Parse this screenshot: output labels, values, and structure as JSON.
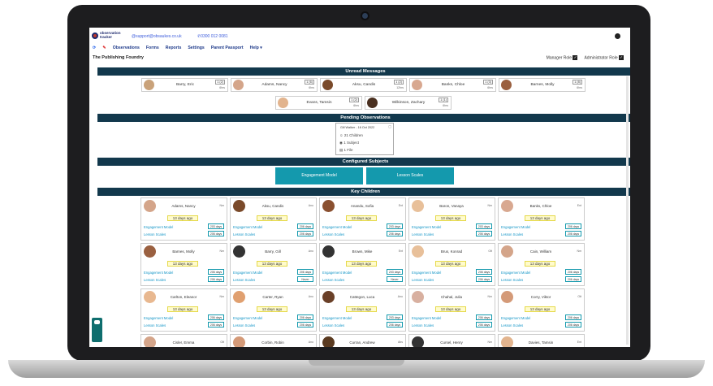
{
  "header": {
    "logo_text": "observation tracker",
    "email": "support@obsaukes.co.uk",
    "phone": "0300 012 0081"
  },
  "nav": {
    "items": [
      "Observations",
      "Forms",
      "Reports",
      "Settings",
      "Parent Passport",
      "Help ▾"
    ]
  },
  "org_name": "The Publishing Foundry",
  "roles": {
    "manager": "Manager Role",
    "administrator": "Administrator Role"
  },
  "sections": {
    "unread": "Unread Messages",
    "pending": "Pending Observations",
    "configured": "Configured Subjects",
    "key_children": "Key Children"
  },
  "messages": [
    {
      "name": "Barry, Eric",
      "count": "1 (2)",
      "age": "6hrs",
      "color": "#c9a27a"
    },
    {
      "name": "Adams, Nancy",
      "count": "1 (6)",
      "age": "6hrs",
      "color": "#d4a58a"
    },
    {
      "name": "Aksu, Candis",
      "count": "1 (2)",
      "age": "12hrs",
      "color": "#7a4a2a"
    },
    {
      "name": "Banks, Chloe",
      "count": "1 (3)",
      "age": "6hrs",
      "color": "#d8a890"
    },
    {
      "name": "Barnes, Molly",
      "count": "1 (8)",
      "age": "6hrs",
      "color": "#9a6040"
    },
    {
      "name": "Evans, Tamsin",
      "count": "1 (2)",
      "age": "6hrs",
      "color": "#e2b48e"
    },
    {
      "name": "Wilkinson, Zachary",
      "count": "1 (1)",
      "age": "6hrs",
      "color": "#4a3020"
    }
  ],
  "pending": {
    "header": "Gill Walker - 16 Oct 2022",
    "children": "21 Children",
    "subject": "1 Subject",
    "file": "1 File"
  },
  "subjects": [
    "Engagement Model",
    "Lesson Scales"
  ],
  "child_labels": {
    "line1": "Engagement Model",
    "line2": "Lesson Scales"
  },
  "children": [
    {
      "name": "Adams, Nancy",
      "ct": "Nm",
      "ago": "13 days ago",
      "b1": "203 days",
      "b2": "206 days",
      "color": "#d4a58a"
    },
    {
      "name": "Aksu, Candis",
      "ct": "Ano",
      "ago": "13 days ago",
      "b1": "206 days",
      "b2": "206 days",
      "color": "#7a4a2a"
    },
    {
      "name": "Anandu, Sofia",
      "ct": "Ent",
      "ago": "13 days ago",
      "b1": "203 days",
      "b2": "206 days",
      "color": "#8a5030"
    },
    {
      "name": "Baron, Vanaya",
      "ct": "Nm",
      "ago": "13 days ago",
      "b1": "203 days",
      "b2": "206 days",
      "color": "#e8c09a"
    },
    {
      "name": "Banks, Chloe",
      "ct": "Ent",
      "ago": "13 days ago",
      "b1": "206 days",
      "b2": "206 days",
      "color": "#d8a890"
    },
    {
      "name": "Barnes, Molly",
      "ct": "Nm",
      "ago": "13 days ago",
      "b1": "206 days",
      "b2": "206 days",
      "color": "#9a6040"
    },
    {
      "name": "Barry, Gill",
      "ct": "Ano",
      "ago": "13 days ago",
      "b1": "206 days",
      "b2": "Never",
      "color": "#333333"
    },
    {
      "name": "Brown, Mike",
      "ct": "Ent",
      "ago": "13 days ago",
      "b1": "203 days",
      "b2": "Never",
      "color": "#333333"
    },
    {
      "name": "Brus, Konrad",
      "ct": "Ott",
      "ago": "13 days ago",
      "b1": "206 days",
      "b2": "206 days",
      "color": "#e8c09a"
    },
    {
      "name": "Cain, William",
      "ct": "Nm",
      "ago": "13 days ago",
      "b1": "206 days",
      "b2": "206 days",
      "color": "#d4a58a"
    },
    {
      "name": "Carlton, Eleanor",
      "ct": "Nm",
      "ago": "13 days ago",
      "b1": "206 days",
      "b2": "206 days",
      "color": "#e8b890"
    },
    {
      "name": "Carter, Ryan",
      "ct": "Ano",
      "ago": "13 days ago",
      "b1": "206 days",
      "b2": "206 days",
      "color": "#e0a070"
    },
    {
      "name": "Cattegon, Luca",
      "ct": "Ano",
      "ago": "13 days ago",
      "b1": "203 days",
      "b2": "206 days",
      "color": "#6a4028"
    },
    {
      "name": "Chahal, Julia",
      "ct": "Nm",
      "ago": "13 days ago",
      "b1": "206 days",
      "b2": "206 days",
      "color": "#d8b0a0"
    },
    {
      "name": "Corry, Viktor",
      "ct": "Ott",
      "ago": "13 days ago",
      "b1": "206 days",
      "b2": "206 days",
      "color": "#d49a78"
    },
    {
      "name": "Cisler, Emma",
      "ct": "Ott",
      "ago": "",
      "b1": "",
      "b2": "",
      "color": "#d4a58a"
    },
    {
      "name": "Corbin, Robin",
      "ct": "Ano",
      "ago": "",
      "b1": "",
      "b2": "",
      "color": "#d49a78"
    },
    {
      "name": "Curran, Andrew",
      "ct": "Abs",
      "ago": "",
      "b1": "",
      "b2": "",
      "color": "#5a3a20"
    },
    {
      "name": "Cursel, Henry",
      "ct": "Nm",
      "ago": "",
      "b1": "",
      "b2": "",
      "color": "#333333"
    },
    {
      "name": "Davies, Tamsin",
      "ct": "Ent",
      "ago": "",
      "b1": "",
      "b2": "",
      "color": "#e2b48e"
    }
  ]
}
